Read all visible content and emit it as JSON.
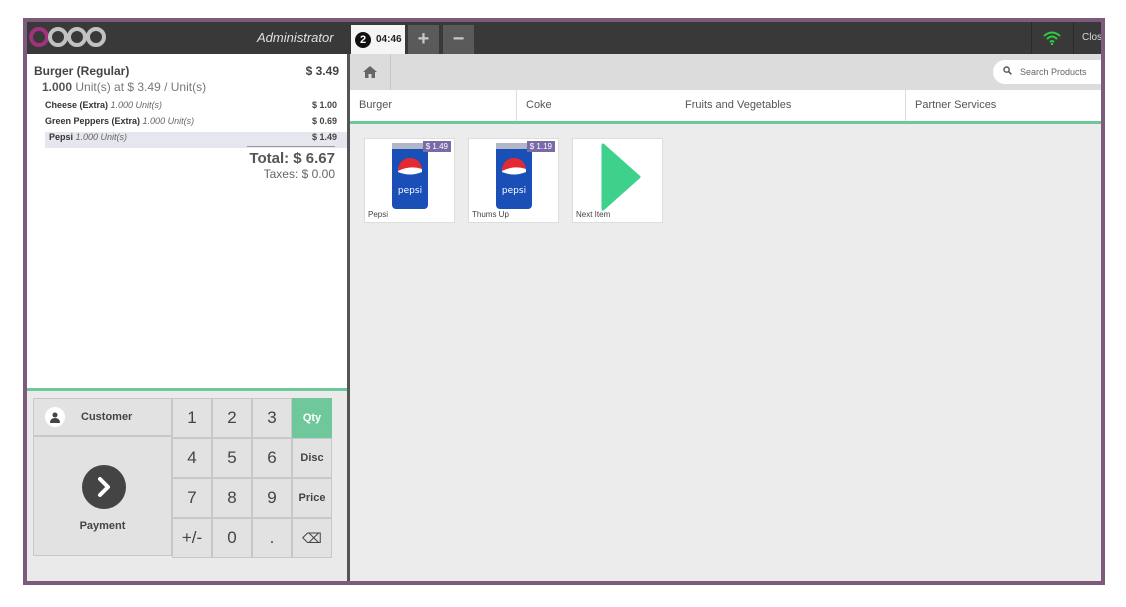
{
  "topbar": {
    "user": "Administrator",
    "order_number": "2",
    "order_time": "04:46",
    "add_order_label": "+",
    "remove_order_label": "−",
    "close_label": "Close"
  },
  "order": {
    "main_line": {
      "name": "Burger (Regular)",
      "price": "$ 3.49",
      "qty": "1.000",
      "info": " Unit(s) at $ 3.49 / Unit(s)"
    },
    "sub_lines": [
      {
        "name": "Cheese (Extra)",
        "qty": " 1.000 Unit(s)",
        "price": "$ 1.00"
      },
      {
        "name": "Green Peppers (Extra)",
        "qty": " 1.000 Unit(s)",
        "price": "$ 0.69"
      },
      {
        "name": "Pepsi",
        "qty": " 1.000 Unit(s)",
        "price": "$ 1.49"
      }
    ],
    "total": "Total: $ 6.67",
    "taxes": "Taxes: $ 0.00"
  },
  "pad": {
    "customer_label": "Customer",
    "payment_label": "Payment",
    "keys": [
      "1",
      "2",
      "3",
      "Qty",
      "4",
      "5",
      "6",
      "Disc",
      "7",
      "8",
      "9",
      "Price",
      "+/-",
      "0",
      ".",
      "⌫"
    ]
  },
  "products": {
    "search_placeholder": "Search Products",
    "categories": [
      "Burger",
      "Coke",
      "Fruits and Vegetables",
      "Partner Services"
    ],
    "items": [
      {
        "name": "Pepsi",
        "price": "$ 1.49"
      },
      {
        "name": "Thums Up",
        "price": "$ 1.19"
      },
      {
        "name": "Next Item",
        "price": ""
      }
    ]
  },
  "colors": {
    "accent": "#6ec89b",
    "frame": "#7c5b7d",
    "price_tag": "#7b6aa8",
    "wifi": "#2ecc40"
  }
}
